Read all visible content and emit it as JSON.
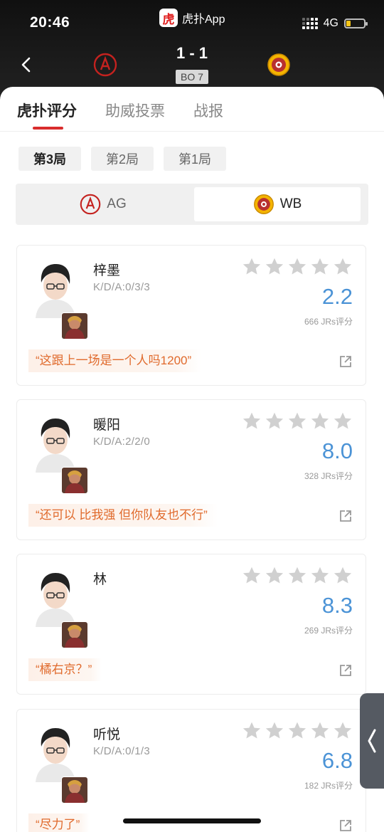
{
  "status": {
    "time": "20:46",
    "network": "4G",
    "battery_level": 0.25
  },
  "app": {
    "logo_char": "虎",
    "name": "虎扑App"
  },
  "match": {
    "score": "1 - 1",
    "format": "BO 7"
  },
  "tabs": [
    {
      "label": "虎扑评分",
      "active": true
    },
    {
      "label": "助威投票",
      "active": false
    },
    {
      "label": "战报",
      "active": false
    }
  ],
  "rounds": [
    {
      "label": "第3局",
      "active": true
    },
    {
      "label": "第2局",
      "active": false
    },
    {
      "label": "第1局",
      "active": false
    }
  ],
  "teams": [
    {
      "label": "AG",
      "active": false,
      "icon": "ag-logo-icon"
    },
    {
      "label": "WB",
      "active": true,
      "icon": "wb-logo-icon"
    }
  ],
  "players": [
    {
      "name": "梓墨",
      "kda": "K/D/A:0/3/3",
      "score": "2.2",
      "votes": "666 JRs评分",
      "quote": "“这跟上一场是一个人吗1200”",
      "stars_filled": 0
    },
    {
      "name": "暖阳",
      "kda": "K/D/A:2/2/0",
      "score": "8.0",
      "votes": "328 JRs评分",
      "quote": "“还可以 比我强 但你队友也不行”",
      "stars_filled": 0
    },
    {
      "name": "林",
      "kda": "",
      "score": "8.3",
      "votes": "269 JRs评分",
      "quote": "“橘右京？”",
      "stars_filled": 0
    },
    {
      "name": "听悦",
      "kda": "K/D/A:0/1/3",
      "score": "6.8",
      "votes": "182 JRs评分",
      "quote": "“尽力了”",
      "stars_filled": 0
    }
  ],
  "colors": {
    "accent": "#d92d2d",
    "score": "#4b93d6",
    "quote": "#e06a2c",
    "star_empty": "#d0d0d0"
  }
}
